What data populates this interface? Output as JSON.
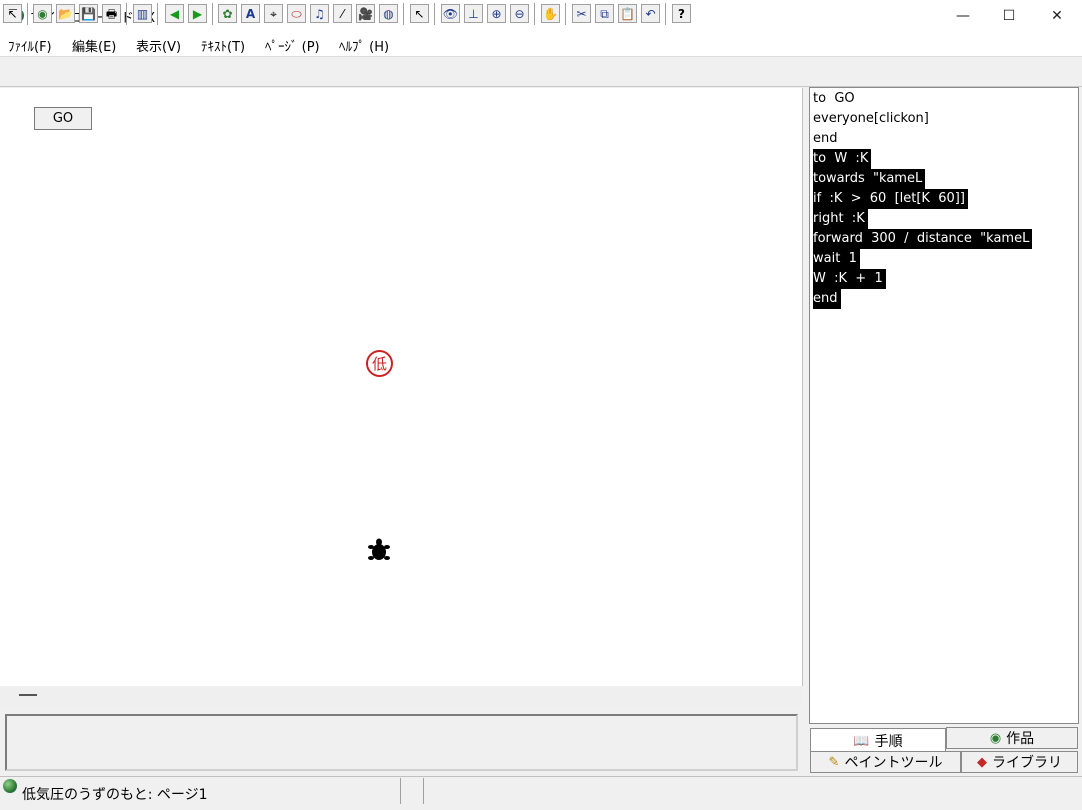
{
  "window": {
    "title": "マイクロワールド EX",
    "controls": {
      "minimize": "—",
      "maximize": "☐",
      "close": "✕"
    }
  },
  "menu": [
    {
      "label": "ﾌｧｲﾙ(F)"
    },
    {
      "label": "編集(E)"
    },
    {
      "label": "表示(V)"
    },
    {
      "label": "ﾃｷｽﾄ(T)"
    },
    {
      "label": "ﾍﾟｰｼﾞ (P)"
    },
    {
      "label": "ﾍﾙﾌﾟ (H)"
    }
  ],
  "toolbar": [
    {
      "name": "select-arrow",
      "glyph": "↸"
    },
    {
      "name": "globe",
      "glyph": "◉"
    },
    {
      "name": "open-folder",
      "glyph": "📂"
    },
    {
      "name": "save",
      "glyph": "💾"
    },
    {
      "name": "print",
      "glyph": "🖶"
    },
    {
      "name": "project-view",
      "glyph": "▥"
    },
    {
      "name": "previous-page",
      "glyph": "◀"
    },
    {
      "name": "next-page",
      "glyph": "▶"
    },
    {
      "name": "new-turtle",
      "glyph": "✿"
    },
    {
      "name": "text-box",
      "glyph": "A"
    },
    {
      "name": "button-tool",
      "glyph": "⌖"
    },
    {
      "name": "slider-tool",
      "glyph": "⬭"
    },
    {
      "name": "music-note",
      "glyph": "♫"
    },
    {
      "name": "magic-wand",
      "glyph": "⁄"
    },
    {
      "name": "video-camera",
      "glyph": "🎥"
    },
    {
      "name": "record-sound",
      "glyph": "◍"
    },
    {
      "name": "pointer-arrow",
      "glyph": "↖"
    },
    {
      "name": "eye-view",
      "glyph": "👁"
    },
    {
      "name": "stamp",
      "glyph": "⊥"
    },
    {
      "name": "grow",
      "glyph": "⊕"
    },
    {
      "name": "shrink",
      "glyph": "⊖"
    },
    {
      "name": "stop-hand",
      "glyph": "✋"
    },
    {
      "name": "cut",
      "glyph": "✂"
    },
    {
      "name": "copy",
      "glyph": "⧉"
    },
    {
      "name": "paste",
      "glyph": "📋"
    },
    {
      "name": "undo",
      "glyph": "↶"
    },
    {
      "name": "help-question",
      "glyph": "?"
    }
  ],
  "canvas": {
    "go_button_label": "GO",
    "stamp_label": "低"
  },
  "procedures": [
    {
      "text": "to  GO",
      "selected": false
    },
    {
      "text": "everyone[clickon]",
      "selected": false
    },
    {
      "text": "end",
      "selected": false
    },
    {
      "text": "to  W  :K",
      "selected": true
    },
    {
      "text": "towards  \"kameL",
      "selected": true
    },
    {
      "text": "if  :K  >  60  [let[K  60]]",
      "selected": true
    },
    {
      "text": "right  :K",
      "selected": true
    },
    {
      "text": "forward  300  /  distance  \"kameL",
      "selected": true
    },
    {
      "text": "wait  1",
      "selected": true
    },
    {
      "text": "W  :K  +  1",
      "selected": true
    },
    {
      "text": "end",
      "selected": true
    }
  ],
  "tabs": {
    "procedures": {
      "label": "手順",
      "icon": "open-book-icon"
    },
    "works": {
      "label": "作品",
      "icon": "globe-icon"
    },
    "paint": {
      "label": "ペイントツール",
      "icon": "paintbrush-icon"
    },
    "library": {
      "label": "ライブラリ",
      "icon": "shapes-icon"
    }
  },
  "status": {
    "text": "低気圧のうずのもと: ページ1"
  }
}
